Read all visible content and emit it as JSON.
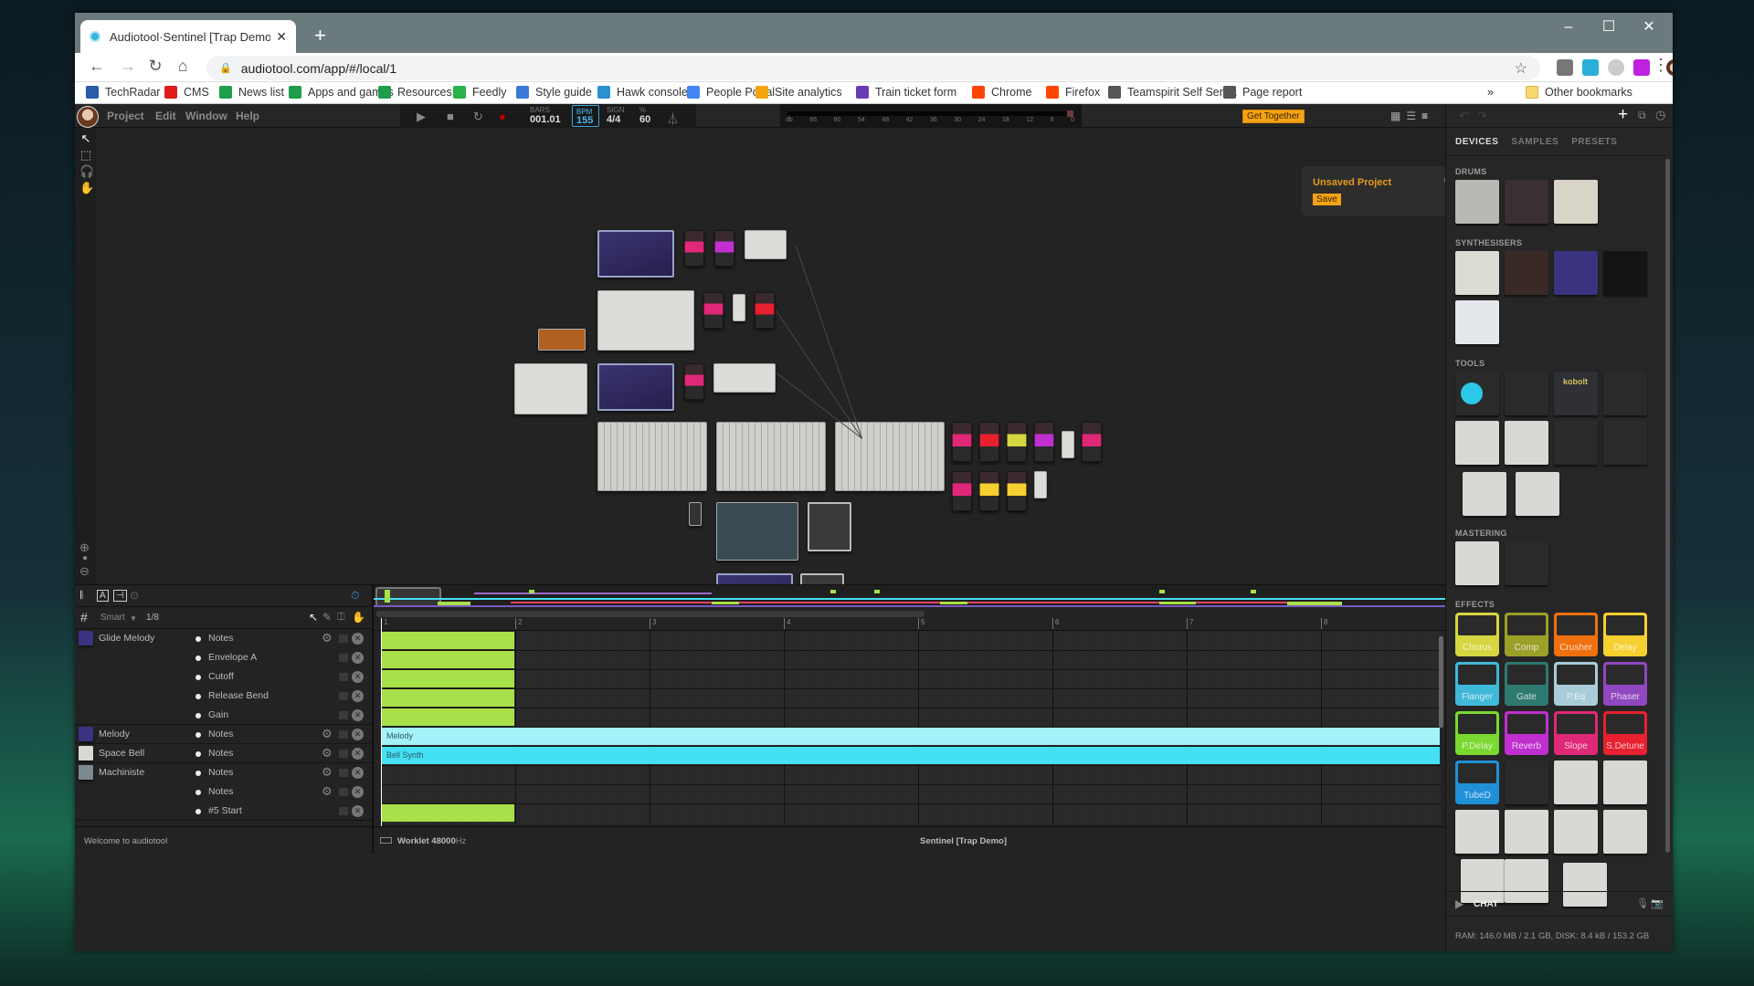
{
  "browser": {
    "tab_title": "Audiotool·Sentinel [Trap Demo]",
    "url": "audiotool.com/app/#/local/1",
    "bookmarks": [
      {
        "label": "TechRadar",
        "icon": "techradar-icon",
        "color": "#2a5aa8"
      },
      {
        "label": "CMS",
        "icon": "cms-icon",
        "color": "#e01b1b"
      },
      {
        "label": "News list",
        "icon": "sheets-icon",
        "color": "#1e9e4a"
      },
      {
        "label": "Apps and games",
        "icon": "sheets-icon",
        "color": "#1e9e4a"
      },
      {
        "label": "Resources",
        "icon": "sheets-icon",
        "color": "#1e9e4a"
      },
      {
        "label": "Feedly",
        "icon": "feedly-icon",
        "color": "#2bb24c"
      },
      {
        "label": "Style guide",
        "icon": "docs-icon",
        "color": "#3b7ad8"
      },
      {
        "label": "Hawk console",
        "icon": "hawk-icon",
        "color": "#2a90d0"
      },
      {
        "label": "People Portal",
        "icon": "google-icon",
        "color": "#4285f4"
      },
      {
        "label": "Site analytics",
        "icon": "analytics-icon",
        "color": "#f4a40c"
      },
      {
        "label": "Train ticket form",
        "icon": "forms-icon",
        "color": "#673ab7"
      },
      {
        "label": "Chrome",
        "icon": "reddit-icon",
        "color": "#ff4500"
      },
      {
        "label": "Firefox",
        "icon": "reddit-icon",
        "color": "#ff4500"
      },
      {
        "label": "Teamspirit Self Serv...",
        "icon": "globe-icon",
        "color": "#555555"
      },
      {
        "label": "Page report",
        "icon": "globe-icon",
        "color": "#555555"
      }
    ],
    "other_bookmarks": "Other bookmarks",
    "more_bookmarks": "»"
  },
  "app": {
    "menu": [
      "Project",
      "Edit",
      "Window",
      "Help"
    ],
    "transport": {
      "bars_label": "BARS",
      "bars_value": "001.01",
      "bpm_label": "BPM",
      "bpm_value": "155",
      "sign_label": "SIGN",
      "sign_value": "4/4",
      "pct_label": "%",
      "pct_value": "60"
    },
    "meter_ticks": [
      "db",
      "66",
      "60",
      "54",
      "48",
      "42",
      "36",
      "30",
      "24",
      "18",
      "12",
      "6",
      "0"
    ],
    "get_together": "Get Together",
    "notice": {
      "title": "Unsaved Project",
      "save": "Save"
    },
    "accent": "#f5a214"
  },
  "panel": {
    "tabs": [
      "DEVICES",
      "SAMPLES",
      "PRESETS"
    ],
    "sections": {
      "drums": "DRUMS",
      "synths": "SYNTHESISERS",
      "tools": "TOOLS",
      "mastering": "MASTERING",
      "effects": "EFFECTS"
    },
    "tools_kobolt": "kobolt",
    "effects": [
      {
        "label": "Chorus",
        "color": "#d6d640"
      },
      {
        "label": "Comp",
        "color": "#9aa028"
      },
      {
        "label": "Crusher",
        "color": "#f07010"
      },
      {
        "label": "Delay",
        "color": "#f5d030"
      },
      {
        "label": "Flanger",
        "color": "#40b8d8"
      },
      {
        "label": "Gate",
        "color": "#2e7a70"
      },
      {
        "label": "P.Eq",
        "color": "#a8ccd8"
      },
      {
        "label": "Phaser",
        "color": "#9048c0"
      },
      {
        "label": "P.Delay",
        "color": "#7ad830"
      },
      {
        "label": "Reverb",
        "color": "#c030d0"
      },
      {
        "label": "Slope",
        "color": "#e02878"
      },
      {
        "label": "S.Detune",
        "color": "#e82030"
      },
      {
        "label": "TubeD",
        "color": "#2090d8"
      }
    ],
    "chat": "CHAT",
    "stats": "RAM: 146.0 MB / 2.1 GB, DISK: 8.4 kB / 153.2 GB"
  },
  "sequencer": {
    "snap": "Smart",
    "quant": "1/8",
    "ruler": [
      "1",
      "2",
      "3",
      "4",
      "5",
      "6",
      "7",
      "8"
    ],
    "tracks": [
      {
        "device": "Glide Melody",
        "param": "Notes",
        "gear": true,
        "thumb": "#3a3480"
      },
      {
        "device": "",
        "param": "Envelope A",
        "gear": false
      },
      {
        "device": "",
        "param": "Cutoff",
        "gear": false
      },
      {
        "device": "",
        "param": "Release Bend",
        "gear": false
      },
      {
        "device": "",
        "param": "Gain",
        "gear": false
      },
      {
        "device": "Melody",
        "param": "Notes",
        "gear": true,
        "thumb": "#3a3480"
      },
      {
        "device": "Space Bell",
        "param": "Notes",
        "gear": true,
        "thumb": "#d8d8d4"
      },
      {
        "device": "Machiniste",
        "param": "Notes",
        "gear": true,
        "thumb": "#7a8a90"
      },
      {
        "device": "",
        "param": "Notes",
        "gear": true
      },
      {
        "device": "",
        "param": "#5 Start",
        "gear": false
      }
    ],
    "regions": [
      {
        "label": "Melody",
        "color": "#a4f2fa"
      },
      {
        "label": "Bell Synth",
        "color": "#44e0f4"
      }
    ]
  },
  "status": {
    "welcome": "Welcome to audiotool",
    "engine": "Worklet 48000",
    "engine_unit": "Hz",
    "project": "Sentinel [Trap Demo]"
  }
}
